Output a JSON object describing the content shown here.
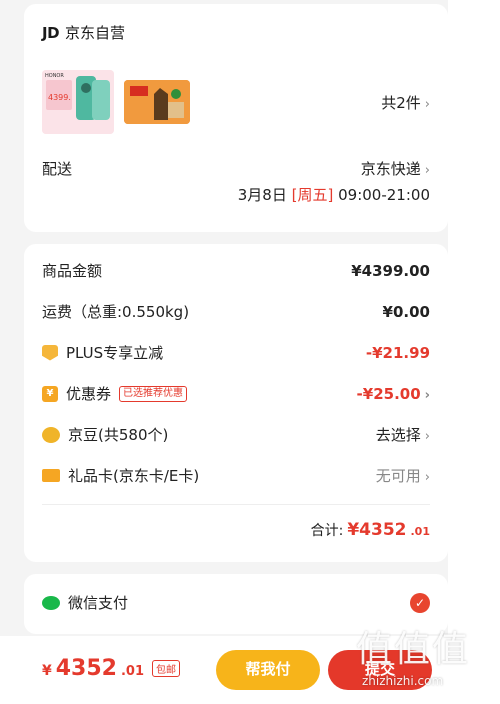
{
  "shop": {
    "name": "京东自营",
    "logo_text": "JD"
  },
  "items": {
    "count_label": "共2件"
  },
  "thumbs": {
    "honor_label": "HONOR",
    "honor_price": "4399."
  },
  "delivery": {
    "label": "配送",
    "method": "京东快递",
    "date": "3月8日",
    "weekday": "[周五]",
    "time": "09:00-21:00"
  },
  "summary": {
    "goods_amount_label": "商品金额",
    "goods_amount": "¥4399.00",
    "shipping_label": "运费（总重:0.550kg)",
    "shipping": "¥0.00",
    "plus_label": "PLUS专享立减",
    "plus_value": "-¥21.99",
    "coupon_label": "优惠券",
    "coupon_tag": "已选推荐优惠",
    "coupon_value": "-¥25.00",
    "jingdou_label": "京豆(共580个)",
    "jingdou_value": "去选择",
    "giftcard_label": "礼品卡(京东卡/E卡)",
    "giftcard_value": "无可用",
    "total_label": "合计:",
    "total_amount": "¥4352",
    "total_decimal": ".01"
  },
  "payment": {
    "method": "微信支付"
  },
  "bottom": {
    "yen": "¥",
    "amount": "4352",
    "decimal": ".01",
    "free_shipping_tag": "包邮",
    "pay_for_label": "帮我付",
    "submit_label": "提交"
  },
  "watermark": {
    "glyphs": "值值值",
    "url": "zhizhizhi.com"
  },
  "colors": {
    "accent": "#e43a2d",
    "yellow": "#f7b41a",
    "wechat": "#19b84a"
  }
}
